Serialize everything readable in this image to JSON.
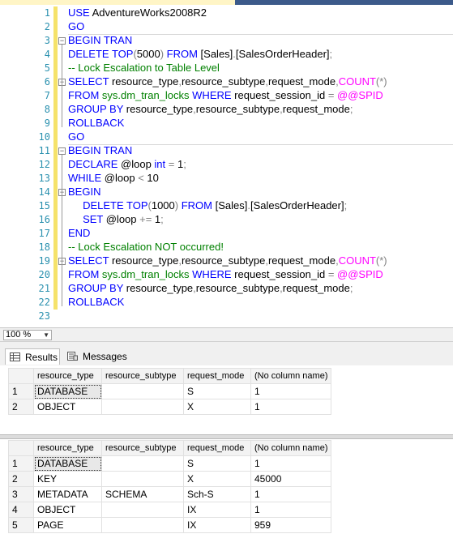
{
  "editor": {
    "lines": [
      {
        "n": "1",
        "tokens": [
          [
            "kw",
            "USE "
          ],
          [
            "",
            "AdventureWorks2008R2"
          ]
        ]
      },
      {
        "n": "2",
        "tokens": [
          [
            "kw",
            "GO"
          ]
        ]
      },
      {
        "n": "3",
        "tokens": [
          [
            "kw",
            "BEGIN TRAN"
          ]
        ]
      },
      {
        "n": "4",
        "tokens": [
          [
            "kw",
            "DELETE TOP"
          ],
          [
            "op",
            "("
          ],
          [
            "",
            "5000"
          ],
          [
            "op",
            ")"
          ],
          [
            "kw",
            " FROM "
          ],
          [
            "",
            "[Sales]"
          ],
          [
            "op",
            "."
          ],
          [
            "",
            "[SalesOrderHeader]"
          ],
          [
            "op",
            ";"
          ]
        ]
      },
      {
        "n": "5",
        "tokens": [
          [
            "cm",
            "-- Lock Escalation to Table Level"
          ]
        ]
      },
      {
        "n": "6",
        "tokens": [
          [
            "kw",
            "SELECT "
          ],
          [
            "",
            "resource_type"
          ],
          [
            "op",
            ","
          ],
          [
            "",
            "resource_subtype"
          ],
          [
            "op",
            ","
          ],
          [
            "",
            "request_mode"
          ],
          [
            "op",
            ","
          ],
          [
            "fn",
            "COUNT"
          ],
          [
            "op",
            "(*)"
          ]
        ]
      },
      {
        "n": "7",
        "tokens": [
          [
            "kw",
            "FROM "
          ],
          [
            "sys",
            "sys.dm_tran_locks"
          ],
          [
            "kw",
            " WHERE "
          ],
          [
            "",
            "request_session_id "
          ],
          [
            "op",
            "="
          ],
          [
            "fn",
            " @@SPID"
          ]
        ]
      },
      {
        "n": "8",
        "tokens": [
          [
            "kw",
            "GROUP BY "
          ],
          [
            "",
            "resource_type"
          ],
          [
            "op",
            ","
          ],
          [
            "",
            "resource_subtype"
          ],
          [
            "op",
            ","
          ],
          [
            "",
            "request_mode"
          ],
          [
            "op",
            ";"
          ]
        ]
      },
      {
        "n": "9",
        "tokens": [
          [
            "kw",
            "ROLLBACK"
          ]
        ]
      },
      {
        "n": "10",
        "tokens": [
          [
            "kw",
            "GO"
          ]
        ]
      },
      {
        "n": "11",
        "tokens": [
          [
            "kw",
            "BEGIN TRAN"
          ]
        ]
      },
      {
        "n": "12",
        "tokens": [
          [
            "kw",
            "DECLARE "
          ],
          [
            "",
            "@loop "
          ],
          [
            "kw",
            "int "
          ],
          [
            "op",
            "="
          ],
          [
            "",
            ""
          ],
          [
            "",
            ""
          ],
          [
            "",
            " 1"
          ],
          [
            "op",
            ";"
          ]
        ]
      },
      {
        "n": "13",
        "tokens": [
          [
            "kw",
            "WHILE "
          ],
          [
            "",
            "@loop "
          ],
          [
            "op",
            "<"
          ],
          [
            "",
            " 10"
          ]
        ]
      },
      {
        "n": "14",
        "tokens": [
          [
            "kw",
            "BEGIN"
          ]
        ]
      },
      {
        "n": "15",
        "tokens": [
          [
            "",
            "     "
          ],
          [
            "kw",
            "DELETE TOP"
          ],
          [
            "op",
            "("
          ],
          [
            "",
            "1000"
          ],
          [
            "op",
            ")"
          ],
          [
            "kw",
            " FROM "
          ],
          [
            "",
            "[Sales]"
          ],
          [
            "op",
            "."
          ],
          [
            "",
            "[SalesOrderHeader]"
          ],
          [
            "op",
            ";"
          ]
        ]
      },
      {
        "n": "16",
        "tokens": [
          [
            "",
            "     "
          ],
          [
            "kw",
            "SET "
          ],
          [
            "",
            "@loop "
          ],
          [
            "op",
            "+="
          ],
          [
            "",
            " 1"
          ],
          [
            "op",
            ";"
          ]
        ]
      },
      {
        "n": "17",
        "tokens": [
          [
            "kw",
            "END"
          ]
        ]
      },
      {
        "n": "18",
        "tokens": [
          [
            "cm",
            "-- Lock Escalation NOT occurred!"
          ]
        ]
      },
      {
        "n": "19",
        "tokens": [
          [
            "kw",
            "SELECT "
          ],
          [
            "",
            "resource_type"
          ],
          [
            "op",
            ","
          ],
          [
            "",
            "resource_subtype"
          ],
          [
            "op",
            ","
          ],
          [
            "",
            "request_mode"
          ],
          [
            "op",
            ","
          ],
          [
            "fn",
            "COUNT"
          ],
          [
            "op",
            "(*)"
          ]
        ]
      },
      {
        "n": "20",
        "tokens": [
          [
            "kw",
            "FROM "
          ],
          [
            "sys",
            "sys.dm_tran_locks"
          ],
          [
            "kw",
            " WHERE "
          ],
          [
            "",
            "request_session_id "
          ],
          [
            "op",
            "="
          ],
          [
            "fn",
            " @@SPID"
          ]
        ]
      },
      {
        "n": "21",
        "tokens": [
          [
            "kw",
            "GROUP BY "
          ],
          [
            "",
            "resource_type"
          ],
          [
            "op",
            ","
          ],
          [
            "",
            "resource_subtype"
          ],
          [
            "op",
            ","
          ],
          [
            "",
            "request_mode"
          ],
          [
            "op",
            ";"
          ]
        ]
      },
      {
        "n": "22",
        "tokens": [
          [
            "kw",
            "ROLLBACK"
          ]
        ]
      },
      {
        "n": "23",
        "tokens": []
      }
    ]
  },
  "zoom": {
    "value": "100 %"
  },
  "tabs": {
    "results": "Results",
    "messages": "Messages"
  },
  "grid1": {
    "headers": [
      "resource_type",
      "resource_subtype",
      "request_mode",
      "(No column name)"
    ],
    "rows": [
      [
        "1",
        "DATABASE",
        "",
        "S",
        "1"
      ],
      [
        "2",
        "OBJECT",
        "",
        "X",
        "1"
      ]
    ]
  },
  "grid2": {
    "headers": [
      "resource_type",
      "resource_subtype",
      "request_mode",
      "(No column name)"
    ],
    "rows": [
      [
        "1",
        "DATABASE",
        "",
        "S",
        "1"
      ],
      [
        "2",
        "KEY",
        "",
        "X",
        "45000"
      ],
      [
        "3",
        "METADATA",
        "SCHEMA",
        "Sch-S",
        "1"
      ],
      [
        "4",
        "OBJECT",
        "",
        "IX",
        "1"
      ],
      [
        "5",
        "PAGE",
        "",
        "IX",
        "959"
      ]
    ]
  }
}
